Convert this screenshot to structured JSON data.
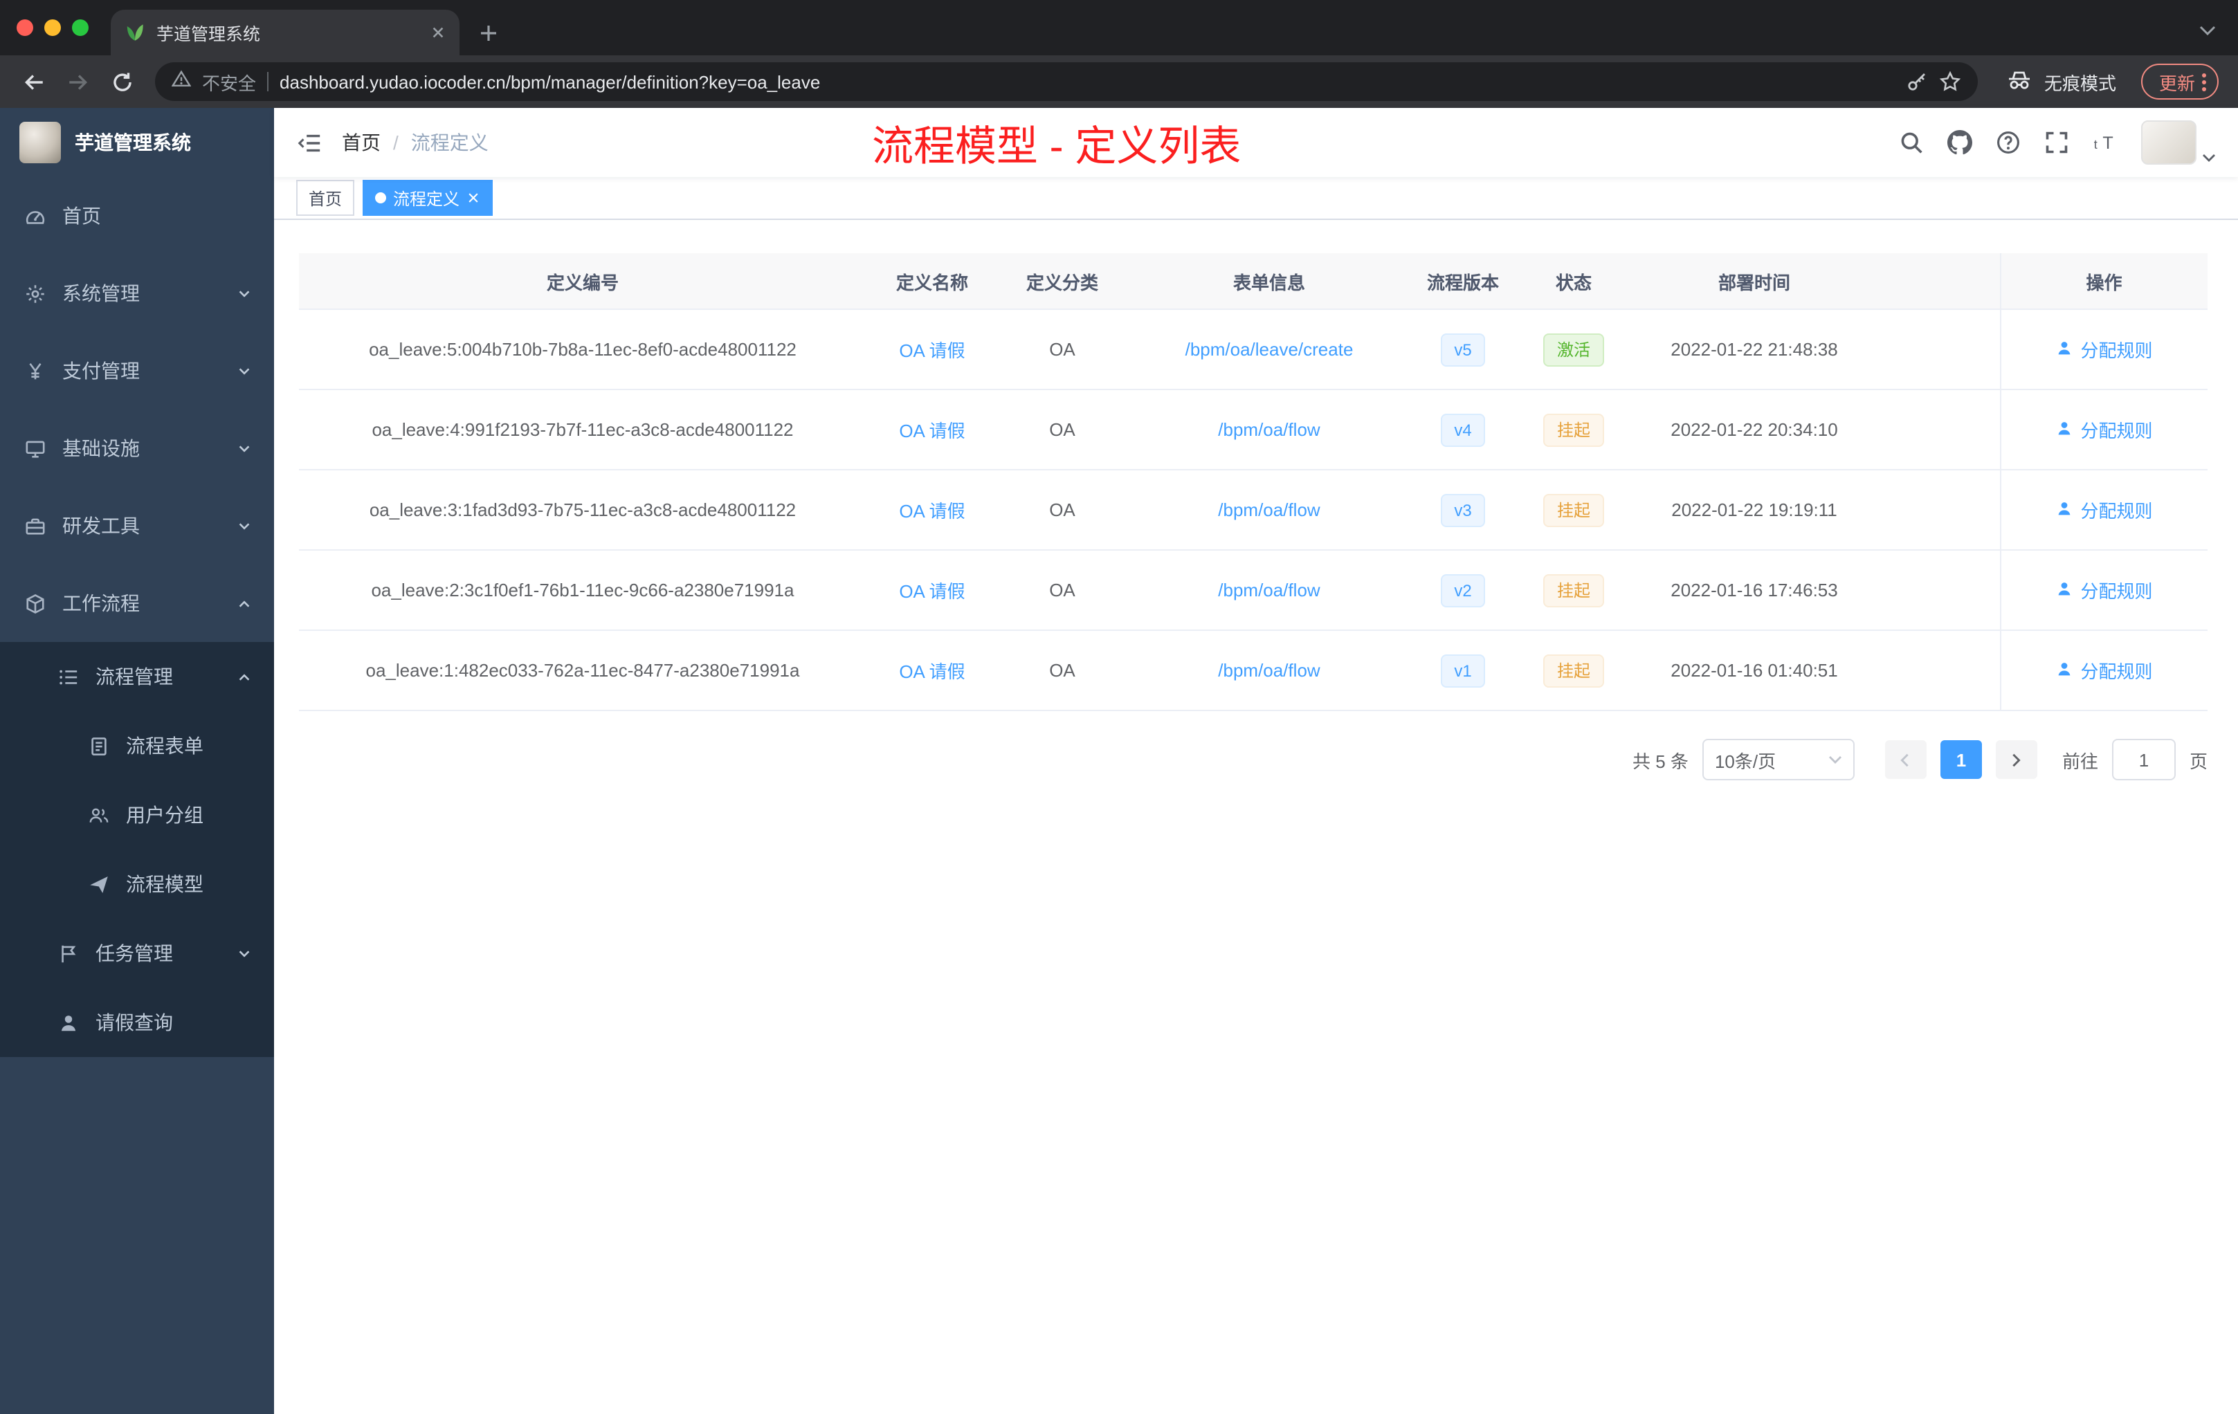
{
  "browser": {
    "tab": {
      "title": "芋道管理系统"
    },
    "toolbar": {
      "security_label": "不安全",
      "url": "dashboard.yudao.iocoder.cn/bpm/manager/definition?key=oa_leave",
      "incognito_label": "无痕模式",
      "update_label": "更新"
    }
  },
  "sidebar": {
    "logo_title": "芋道管理系统",
    "items": [
      {
        "key": "home",
        "label": "首页",
        "icon": "dashboard-icon",
        "level": 1,
        "submenu": false,
        "chevron": null
      },
      {
        "key": "system",
        "label": "系统管理",
        "icon": "gear-icon",
        "level": 1,
        "submenu": false,
        "chevron": "down"
      },
      {
        "key": "payment",
        "label": "支付管理",
        "icon": "yen-icon",
        "level": 1,
        "submenu": false,
        "chevron": "down"
      },
      {
        "key": "infra",
        "label": "基础设施",
        "icon": "monitor-icon",
        "level": 1,
        "submenu": false,
        "chevron": "down"
      },
      {
        "key": "devtools",
        "label": "研发工具",
        "icon": "toolbox-icon",
        "level": 1,
        "submenu": false,
        "chevron": "down"
      },
      {
        "key": "workflow",
        "label": "工作流程",
        "icon": "cube-icon",
        "level": 1,
        "submenu": false,
        "chevron": "up"
      },
      {
        "key": "process-mgmt",
        "label": "流程管理",
        "icon": "list-icon",
        "level": 2,
        "submenu": true,
        "chevron": "up"
      },
      {
        "key": "process-form",
        "label": "流程表单",
        "icon": "form-icon",
        "level": 3,
        "submenu": true,
        "chevron": null
      },
      {
        "key": "user-group",
        "label": "用户分组",
        "icon": "users-icon",
        "level": 3,
        "submenu": true,
        "chevron": null
      },
      {
        "key": "process-model",
        "label": "流程模型",
        "icon": "plane-icon",
        "level": 3,
        "submenu": true,
        "chevron": null
      },
      {
        "key": "task-mgmt",
        "label": "任务管理",
        "icon": "flag-icon",
        "level": 2,
        "submenu": true,
        "chevron": "down"
      },
      {
        "key": "leave-query",
        "label": "请假查询",
        "icon": "person-icon",
        "level": 2,
        "submenu": true,
        "chevron": null
      }
    ]
  },
  "header": {
    "breadcrumb": [
      "首页",
      "流程定义"
    ],
    "annotation": "流程模型 - 定义列表"
  },
  "tags": [
    {
      "label": "首页",
      "active": false,
      "closable": false
    },
    {
      "label": "流程定义",
      "active": true,
      "closable": true
    }
  ],
  "table": {
    "columns": [
      "定义编号",
      "定义名称",
      "定义分类",
      "表单信息",
      "流程版本",
      "状态",
      "部署时间",
      "操作"
    ],
    "rows": [
      {
        "id": "oa_leave:5:004b710b-7b8a-11ec-8ef0-acde48001122",
        "name": "OA 请假",
        "category": "OA",
        "form": "/bpm/oa/leave/create",
        "version": "v5",
        "status": "激活",
        "status_type": "success",
        "deploy_time": "2022-01-22 21:48:38",
        "action": "分配规则"
      },
      {
        "id": "oa_leave:4:991f2193-7b7f-11ec-a3c8-acde48001122",
        "name": "OA 请假",
        "category": "OA",
        "form": "/bpm/oa/flow",
        "version": "v4",
        "status": "挂起",
        "status_type": "warning",
        "deploy_time": "2022-01-22 20:34:10",
        "action": "分配规则"
      },
      {
        "id": "oa_leave:3:1fad3d93-7b75-11ec-a3c8-acde48001122",
        "name": "OA 请假",
        "category": "OA",
        "form": "/bpm/oa/flow",
        "version": "v3",
        "status": "挂起",
        "status_type": "warning",
        "deploy_time": "2022-01-22 19:19:11",
        "action": "分配规则"
      },
      {
        "id": "oa_leave:2:3c1f0ef1-76b1-11ec-9c66-a2380e71991a",
        "name": "OA 请假",
        "category": "OA",
        "form": "/bpm/oa/flow",
        "version": "v2",
        "status": "挂起",
        "status_type": "warning",
        "deploy_time": "2022-01-16 17:46:53",
        "action": "分配规则"
      },
      {
        "id": "oa_leave:1:482ec033-762a-11ec-8477-a2380e71991a",
        "name": "OA 请假",
        "category": "OA",
        "form": "/bpm/oa/flow",
        "version": "v1",
        "status": "挂起",
        "status_type": "warning",
        "deploy_time": "2022-01-16 01:40:51",
        "action": "分配规则"
      }
    ]
  },
  "pagination": {
    "total_label": "共 5 条",
    "page_size": "10条/页",
    "current_page": "1",
    "goto_label": "前往",
    "goto_value": "1",
    "page_label": "页"
  },
  "colors": {
    "accent": "#409eff",
    "success": "#67c23a",
    "warning": "#e6a23c",
    "annotation_red": "#fb1f1f",
    "sidebar_bg": "#304156",
    "submenu_bg": "#1f2d3d"
  }
}
